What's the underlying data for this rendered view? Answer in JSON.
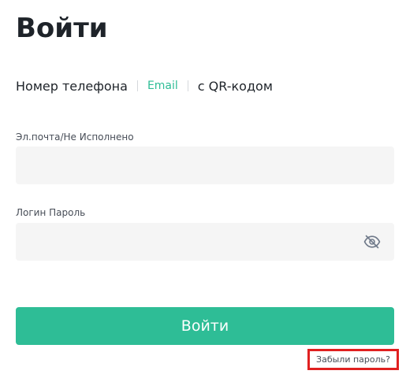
{
  "title": "Войти",
  "tabs": [
    {
      "label": "Номер телефона",
      "active": false
    },
    {
      "label": "Email",
      "active": true
    },
    {
      "label": "с QR-кодом",
      "active": false
    }
  ],
  "email_field": {
    "label": "Эл.почта/Не Исполнено",
    "value": "",
    "placeholder": ""
  },
  "password_field": {
    "label": "Логин Пароль",
    "value": "",
    "placeholder": "",
    "toggle_icon": "eye-slash-icon"
  },
  "submit_label": "Войти",
  "forgot_password_label": "Забыли пароль?",
  "colors": {
    "accent": "#2ebd96",
    "highlight_border": "#e02020",
    "input_background": "#f5f5f5"
  }
}
